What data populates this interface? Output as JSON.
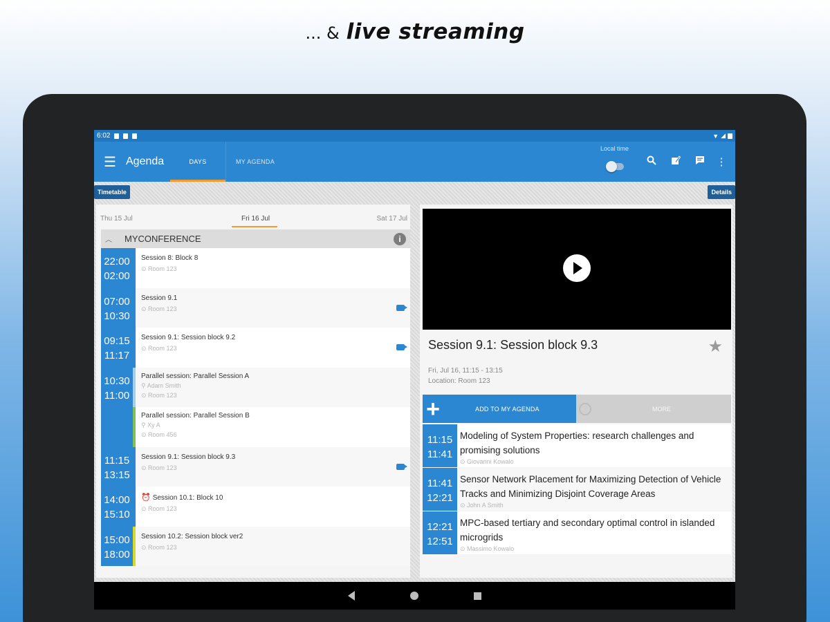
{
  "headline": {
    "prefix": "... &",
    "strong": "live streaming"
  },
  "statusbar": {
    "time": "6:02"
  },
  "appbar": {
    "title": "Agenda",
    "tabs": [
      {
        "label": "DAYS",
        "selected": true
      },
      {
        "label": "MY AGENDA",
        "selected": false
      }
    ],
    "local_time_label": "Local time",
    "icons": [
      "search-icon",
      "edit-icon",
      "notes-icon",
      "more-vert-icon"
    ]
  },
  "subbar": {
    "left_chip": "Timetable",
    "right_chip": "Details"
  },
  "days": {
    "prev": "Thu 15 Jul",
    "current": "Fri 16 Jul",
    "next": "Sat 17 Jul"
  },
  "conference": {
    "title": "MYCONFERENCE",
    "info": "i"
  },
  "sessions": [
    {
      "start": "22:00",
      "end": "02:00",
      "title": "Session 8: Block 8",
      "room": "Room 123",
      "color": "#2b87d1",
      "video": false
    },
    {
      "start": "07:00",
      "end": "10:30",
      "title": "Session 9.1",
      "room": "Room 123",
      "color": "#2b87d1",
      "video": true
    },
    {
      "start": "09:15",
      "end": "11:17",
      "title": "Session 9.1: Session block 9.2",
      "room": "Room 123",
      "color": "#2b87d1",
      "video": true
    },
    {
      "start": "10:30",
      "end": "11:00",
      "title": "Parallel session: Parallel Session A",
      "person": "Adam Smith",
      "room": "Room 123",
      "color": "#2b87d1",
      "video": false
    },
    {
      "start": "",
      "end": "",
      "title": "Parallel session: Parallel Session B",
      "person": "Xy A",
      "room": "Room 456",
      "color": "#7cc254",
      "video": false
    },
    {
      "start": "11:15",
      "end": "13:15",
      "title": "Session 9.1: Session block 9.3",
      "room": "Room 123",
      "color": "#2b87d1",
      "video": true
    },
    {
      "start": "14:00",
      "end": "15:10",
      "title": "Session 10.1: Block 10",
      "room": "Room 123",
      "color": "#2b87d1",
      "video": false,
      "alarm": true
    },
    {
      "start": "15:00",
      "end": "18:00",
      "title": "Session 10.2: Session block ver2",
      "room": "Room 123",
      "color": "#d9d92a",
      "video": false
    }
  ],
  "detail": {
    "title": "Session 9.1: Session block 9.3",
    "datetime": "Fri, Jul 16, 11:15 - 13:15",
    "location": "Location: Room 123",
    "add_label": "ADD TO MY AGENDA",
    "more_label": "MORE",
    "talks": [
      {
        "start": "11:15",
        "end": "11:41",
        "title": "Modeling of System Properties: research challenges and promising solutions",
        "author": "Giovanni Kowalo"
      },
      {
        "start": "11:41",
        "end": "12:21",
        "title": "Sensor Network Placement for Maximizing Detection of Vehicle Tracks and Minimizing Disjoint Coverage Areas",
        "author": "John A Smith"
      },
      {
        "start": "12:21",
        "end": "12:51",
        "title": "MPC-based tertiary and secondary optimal control in islanded microgrids",
        "author": "Massimo Kowalo"
      }
    ]
  }
}
